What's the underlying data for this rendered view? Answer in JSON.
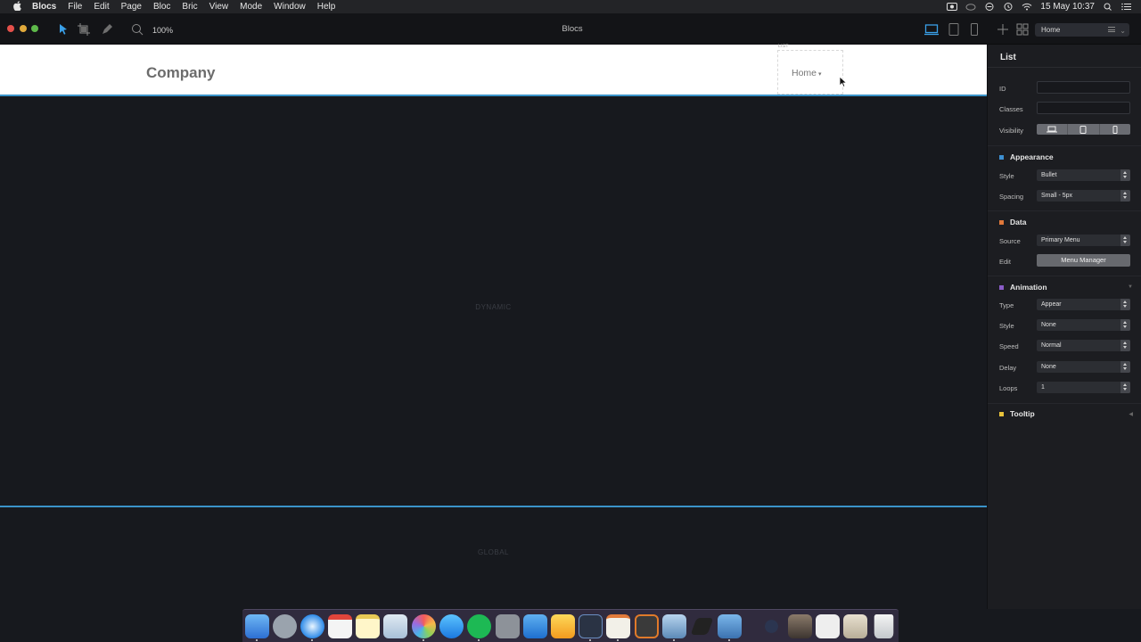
{
  "menubar": {
    "items": [
      "Blocs",
      "File",
      "Edit",
      "Page",
      "Bloc",
      "Bric",
      "View",
      "Mode",
      "Window",
      "Help"
    ],
    "clock": "15 May  10:37"
  },
  "toolbar": {
    "zoom": "100%",
    "window_title": "Blocs",
    "page_select": "Home"
  },
  "canvas": {
    "company": "Company",
    "list_tag": "LIST",
    "nav_item": "Home",
    "dynamic_label": "DYNAMIC",
    "global_label": "GLOBAL"
  },
  "inspector": {
    "title": "List",
    "id_label": "ID",
    "id_value": "",
    "classes_label": "Classes",
    "classes_value": "",
    "visibility_label": "Visibility",
    "appearance": {
      "title": "Appearance",
      "color": "#3d8fd1",
      "style_label": "Style",
      "style_value": "Bullet",
      "spacing_label": "Spacing",
      "spacing_value": "Small - 5px"
    },
    "data": {
      "title": "Data",
      "color": "#e0783a",
      "source_label": "Source",
      "source_value": "Primary Menu",
      "edit_label": "Edit",
      "edit_button": "Menu Manager"
    },
    "animation": {
      "title": "Animation",
      "color": "#8a5cc8",
      "type_label": "Type",
      "type_value": "Appear",
      "style_label": "Style",
      "style_value": "None",
      "speed_label": "Speed",
      "speed_value": "Normal",
      "delay_label": "Delay",
      "delay_value": "None",
      "loops_label": "Loops",
      "loops_value": "1"
    },
    "tooltip": {
      "title": "Tooltip",
      "color": "#e8c23a"
    }
  }
}
